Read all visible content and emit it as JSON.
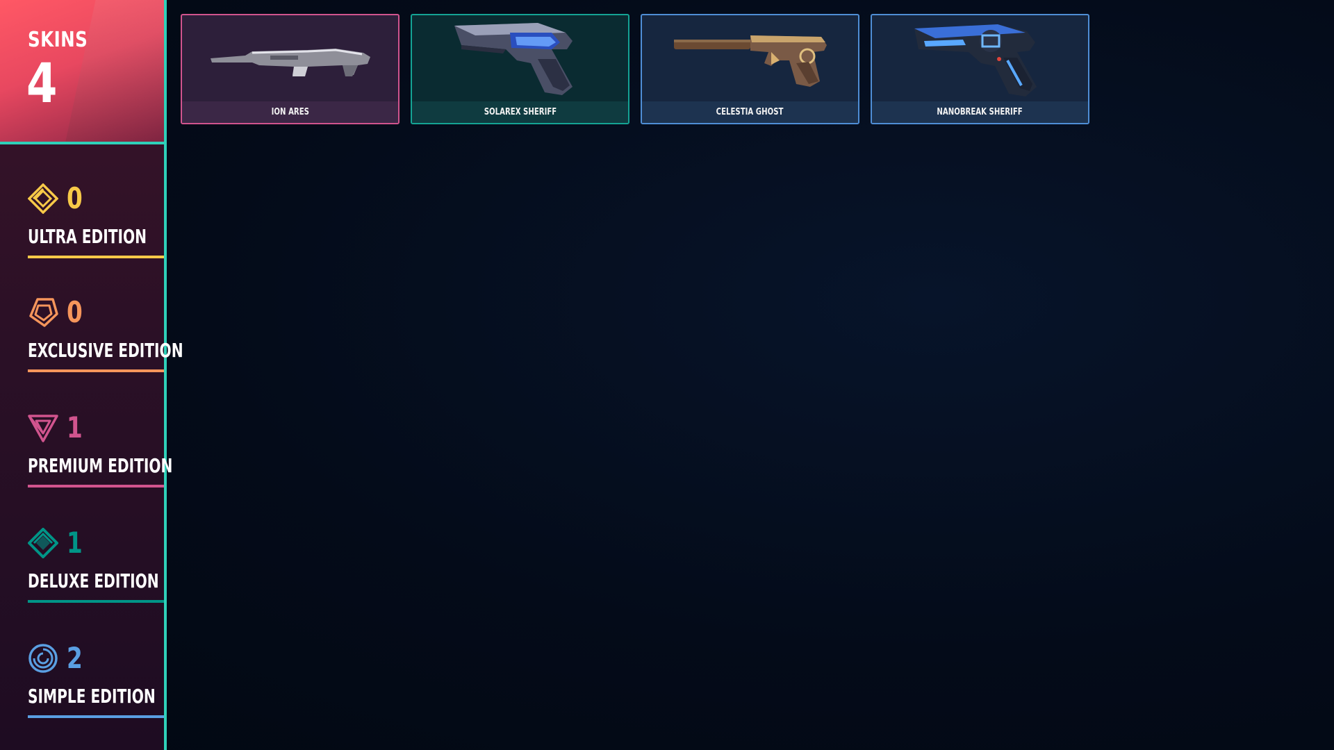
{
  "header": {
    "label": "SKINS",
    "count": "4"
  },
  "tiers": [
    {
      "name": "ULTRA EDITION",
      "count": "0",
      "color": "#f7c948",
      "icon": "ultra-edition-icon"
    },
    {
      "name": "EXCLUSIVE EDITION",
      "count": "0",
      "color": "#f5955b",
      "icon": "exclusive-edition-icon"
    },
    {
      "name": "PREMIUM EDITION",
      "count": "1",
      "color": "#d1548e",
      "icon": "premium-edition-icon"
    },
    {
      "name": "DELUXE EDITION",
      "count": "1",
      "color": "#009587",
      "icon": "deluxe-edition-icon"
    },
    {
      "name": "SIMPLE EDITION",
      "count": "2",
      "color": "#5a9fe2",
      "icon": "simple-edition-icon"
    }
  ],
  "skins": [
    {
      "name": "ION ARES",
      "tier": "premium",
      "border": "#d1548e",
      "bg": "#2d1f3a",
      "footer": "#3b2746",
      "icon": "ares-rifle-icon"
    },
    {
      "name": "SOLAREX SHERIFF",
      "tier": "deluxe",
      "border": "#14a394",
      "bg": "#0a2b31",
      "footer": "#0f3b40",
      "icon": "sheriff-revolver-icon"
    },
    {
      "name": "CELESTIA GHOST",
      "tier": "simple",
      "border": "#4f8ed6",
      "bg": "#16263f",
      "footer": "#1d3350",
      "icon": "ghost-pistol-icon"
    },
    {
      "name": "NANOBREAK SHERIFF",
      "tier": "simple",
      "border": "#4f8ed6",
      "bg": "#16263f",
      "footer": "#1d3350",
      "icon": "sheriff-revolver-icon"
    }
  ],
  "colors": {
    "accent": "#2fd0b9",
    "header_red": "#ff5865",
    "background": "#030a17"
  }
}
